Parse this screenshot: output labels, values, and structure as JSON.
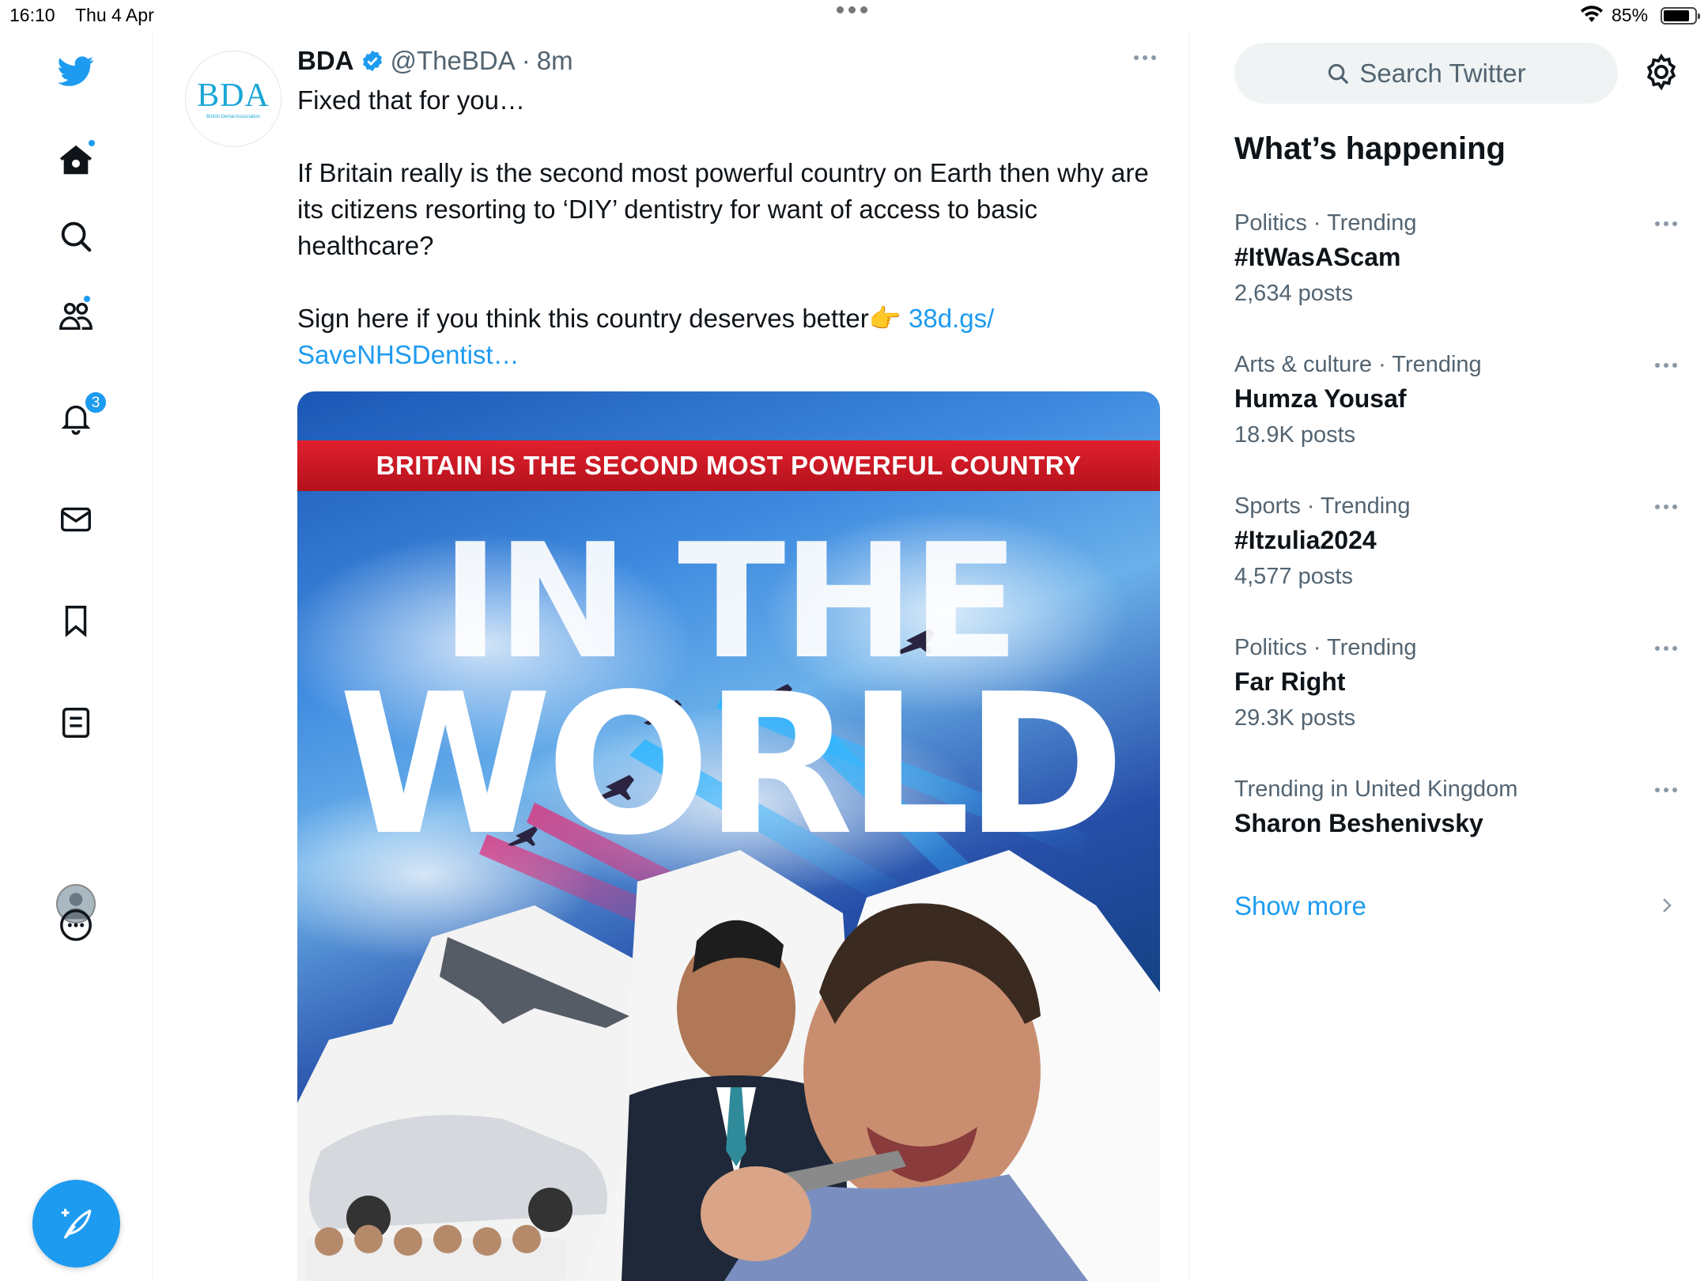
{
  "status_bar": {
    "time": "16:10",
    "date": "Thu 4 Apr",
    "battery_percent": "85%",
    "battery_level": 0.85
  },
  "nav": {
    "icons": [
      "twitter-bird-icon",
      "home-icon",
      "search-icon",
      "communities-icon",
      "notifications-icon",
      "messages-icon",
      "bookmarks-icon",
      "lists-icon",
      "profile-icon",
      "more-icon"
    ],
    "notifications_badge": "3",
    "compose_icon": "compose-quill-icon"
  },
  "tweet": {
    "avatar_logo": "BDA",
    "avatar_sub": "British Dental Association",
    "author_name": "BDA",
    "verified": true,
    "handle": "@TheBDA",
    "separator": "·",
    "time": "8m",
    "text_line1": "Fixed that for you…",
    "text_para2": "If Britain really is the second most powerful country on Earth then why are its citizens resorting to ‘DIY’ dentistry for want of access to basic healthcare?",
    "text_para3": "Sign here if you think this country deserves better👉 ",
    "link_text": "38d.gs/\nSaveNHSDentist…",
    "media": {
      "banner_text": "BRITAIN IS THE SECOND MOST POWERFUL COUNTRY",
      "headline_line1": "IN THE",
      "headline_line2": "WORLD"
    }
  },
  "sidebar": {
    "search_placeholder": "Search Twitter",
    "section_title": "What’s happening",
    "trends": [
      {
        "category": "Politics · Trending",
        "topic": "#ItWasAScam",
        "count": "2,634 posts"
      },
      {
        "category": "Arts & culture · Trending",
        "topic": "Humza Yousaf",
        "count": "18.9K posts"
      },
      {
        "category": "Sports · Trending",
        "topic": "#Itzulia2024",
        "count": "4,577 posts"
      },
      {
        "category": "Politics · Trending",
        "topic": "Far Right",
        "count": "29.3K posts"
      },
      {
        "category": "Trending in United Kingdom",
        "topic": "Sharon Beshenivsky",
        "count": ""
      }
    ],
    "show_more": "Show more"
  },
  "colors": {
    "accent": "#1d9bf0",
    "text_primary": "#0f1419",
    "text_secondary": "#536471",
    "banner_red": "#d01b27"
  }
}
